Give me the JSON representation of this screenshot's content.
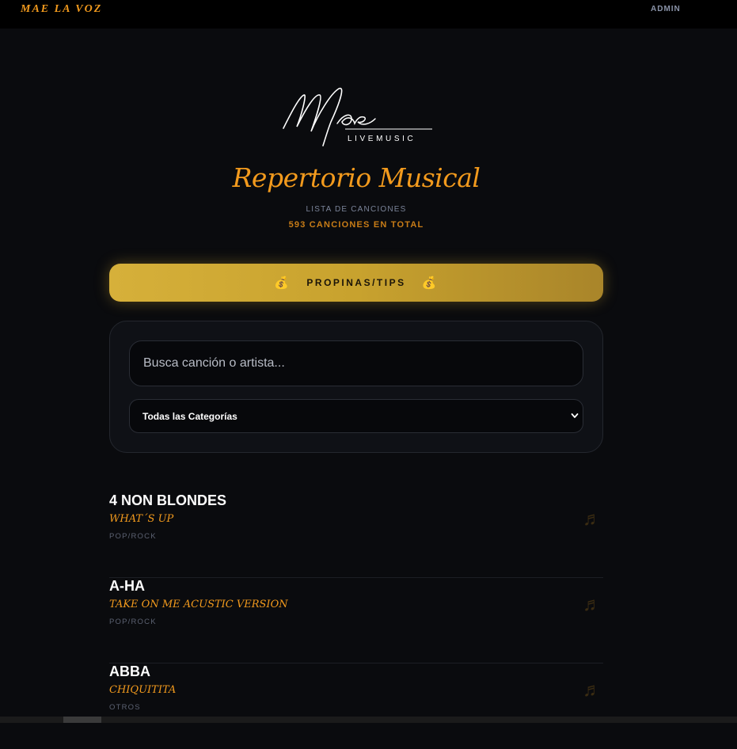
{
  "header": {
    "brand": "MAE LA VOZ",
    "admin": "ADMIN"
  },
  "logo": {
    "script": "Mae",
    "tagline": "LIVEMUSIC"
  },
  "hero": {
    "title": "Repertorio Musical",
    "subtitle": "LISTA DE CANCIONES",
    "count": "593 CANCIONES EN TOTAL"
  },
  "tips_button": {
    "label": "PROPINAS/TIPS",
    "icon": "money-bag-icon"
  },
  "search": {
    "placeholder": "Busca canción o artista...",
    "value": "",
    "category_selected": "Todas las Categorías"
  },
  "songs": [
    {
      "artist": "4 NON BLONDES",
      "title": "WHAT´S UP",
      "category": "POP/ROCK",
      "icon": "music-note-icon"
    },
    {
      "artist": "A-HA",
      "title": "TAKE ON ME ACUSTIC VERSION",
      "category": "POP/ROCK",
      "icon": "music-note-icon"
    },
    {
      "artist": "ABBA",
      "title": "CHIQUITITA",
      "category": "OTROS",
      "icon": "music-note-icon"
    }
  ],
  "colors": {
    "accent": "#f29a1d",
    "gold": "#d6b03a",
    "background": "#0a0b0e"
  }
}
